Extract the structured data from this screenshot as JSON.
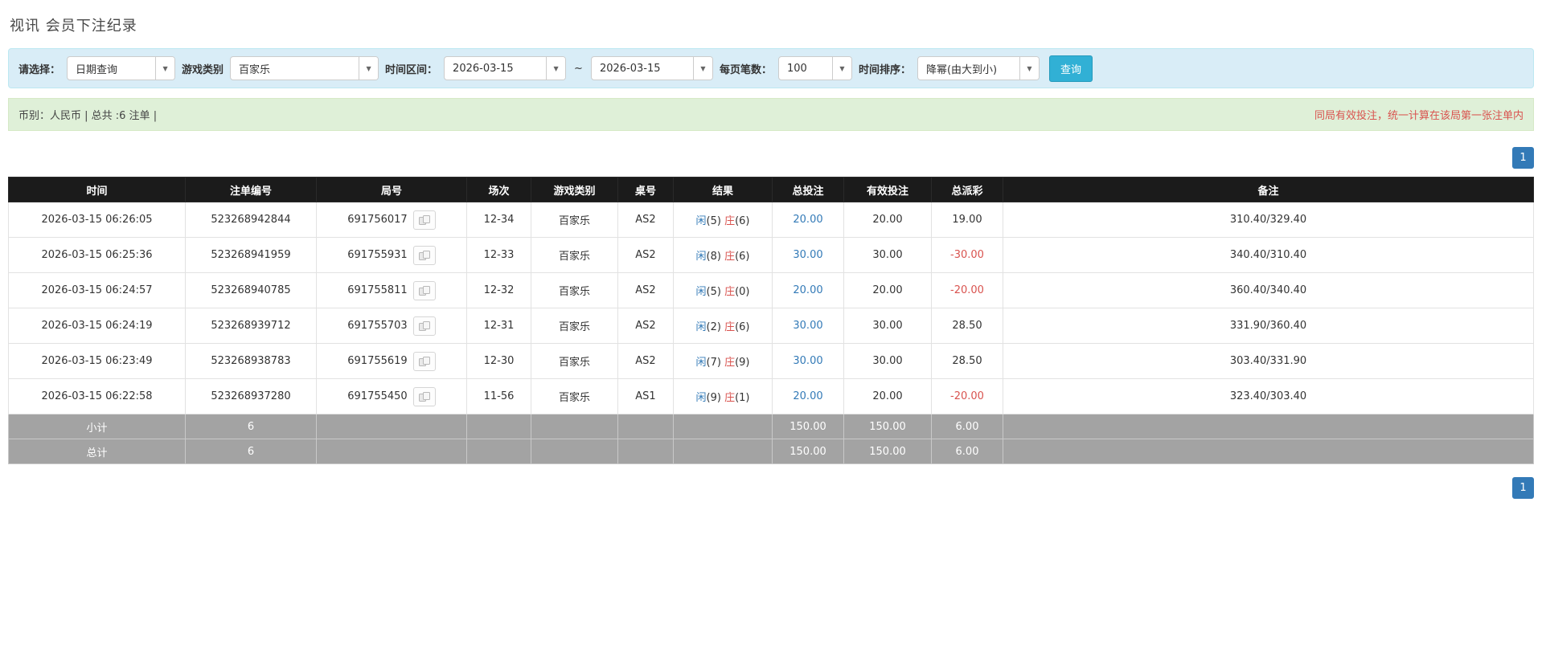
{
  "page": {
    "title": "视讯 会员下注纪录"
  },
  "filter": {
    "query_type_label": "请选择：",
    "query_type_value": "日期查询",
    "game_type_label": "游戏类别",
    "game_type_value": "百家乐",
    "date_range_label": "时间区间：",
    "date_from": "2026-03-15",
    "range_separator": "~",
    "date_to": "2026-03-15",
    "page_size_label": "每页笔数：",
    "page_size_value": "100",
    "sort_label": "时间排序：",
    "sort_value": "降幂(由大到小)",
    "search_button_label": "查询"
  },
  "summary": {
    "left_text": "币别：人民币 | 总共 :6 注单 |",
    "right_text": "同局有效投注，统一计算在该局第一张注单内"
  },
  "pagination": {
    "current_page": "1"
  },
  "table": {
    "headers": [
      "时间",
      "注单编号",
      "局号",
      "场次",
      "游戏类别",
      "桌号",
      "结果",
      "总投注",
      "有效投注",
      "总派彩",
      "备注"
    ],
    "rows": [
      {
        "time": "2026-03-15 06:26:05",
        "bet_id": "523268942844",
        "round_id": "691756017",
        "session": "12-34",
        "game_type": "百家乐",
        "table_no": "AS2",
        "result": {
          "player": "闲",
          "player_score": "(5)",
          "banker": "庄",
          "banker_score": "(6)"
        },
        "total_bet": "20.00",
        "valid_bet": "20.00",
        "payout": "19.00",
        "note": "310.40/329.40"
      },
      {
        "time": "2026-03-15 06:25:36",
        "bet_id": "523268941959",
        "round_id": "691755931",
        "session": "12-33",
        "game_type": "百家乐",
        "table_no": "AS2",
        "result": {
          "player": "闲",
          "player_score": "(8)",
          "banker": "庄",
          "banker_score": "(6)"
        },
        "total_bet": "30.00",
        "valid_bet": "30.00",
        "payout": "-30.00",
        "note": "340.40/310.40"
      },
      {
        "time": "2026-03-15 06:24:57",
        "bet_id": "523268940785",
        "round_id": "691755811",
        "session": "12-32",
        "game_type": "百家乐",
        "table_no": "AS2",
        "result": {
          "player": "闲",
          "player_score": "(5)",
          "banker": "庄",
          "banker_score": "(0)"
        },
        "total_bet": "20.00",
        "valid_bet": "20.00",
        "payout": "-20.00",
        "note": "360.40/340.40"
      },
      {
        "time": "2026-03-15 06:24:19",
        "bet_id": "523268939712",
        "round_id": "691755703",
        "session": "12-31",
        "game_type": "百家乐",
        "table_no": "AS2",
        "result": {
          "player": "闲",
          "player_score": "(2)",
          "banker": "庄",
          "banker_score": "(6)"
        },
        "total_bet": "30.00",
        "valid_bet": "30.00",
        "payout": "28.50",
        "note": "331.90/360.40"
      },
      {
        "time": "2026-03-15 06:23:49",
        "bet_id": "523268938783",
        "round_id": "691755619",
        "session": "12-30",
        "game_type": "百家乐",
        "table_no": "AS2",
        "result": {
          "player": "闲",
          "player_score": "(7)",
          "banker": "庄",
          "banker_score": "(9)"
        },
        "total_bet": "30.00",
        "valid_bet": "30.00",
        "payout": "28.50",
        "note": "303.40/331.90"
      },
      {
        "time": "2026-03-15 06:22:58",
        "bet_id": "523268937280",
        "round_id": "691755450",
        "session": "11-56",
        "game_type": "百家乐",
        "table_no": "AS1",
        "result": {
          "player": "闲",
          "player_score": "(9)",
          "banker": "庄",
          "banker_score": "(1)"
        },
        "total_bet": "20.00",
        "valid_bet": "20.00",
        "payout": "-20.00",
        "note": "323.40/303.40"
      }
    ],
    "footer": [
      {
        "label": "小计",
        "count": "6",
        "total_bet": "150.00",
        "valid_bet": "150.00",
        "payout": "6.00"
      },
      {
        "label": "总计",
        "count": "6",
        "total_bet": "150.00",
        "valid_bet": "150.00",
        "payout": "6.00"
      }
    ]
  },
  "colors": {
    "accent_blue": "#337ab7",
    "search_blue": "#31b0d5",
    "neg_red": "#d9534f",
    "player_blue": "#337ab7",
    "banker_red": "#d9534f",
    "filter_bg": "#d9edf7",
    "summary_bg": "#dff0d8",
    "header_bg": "#1b1b1b",
    "foot_bg": "#a3a3a3"
  }
}
